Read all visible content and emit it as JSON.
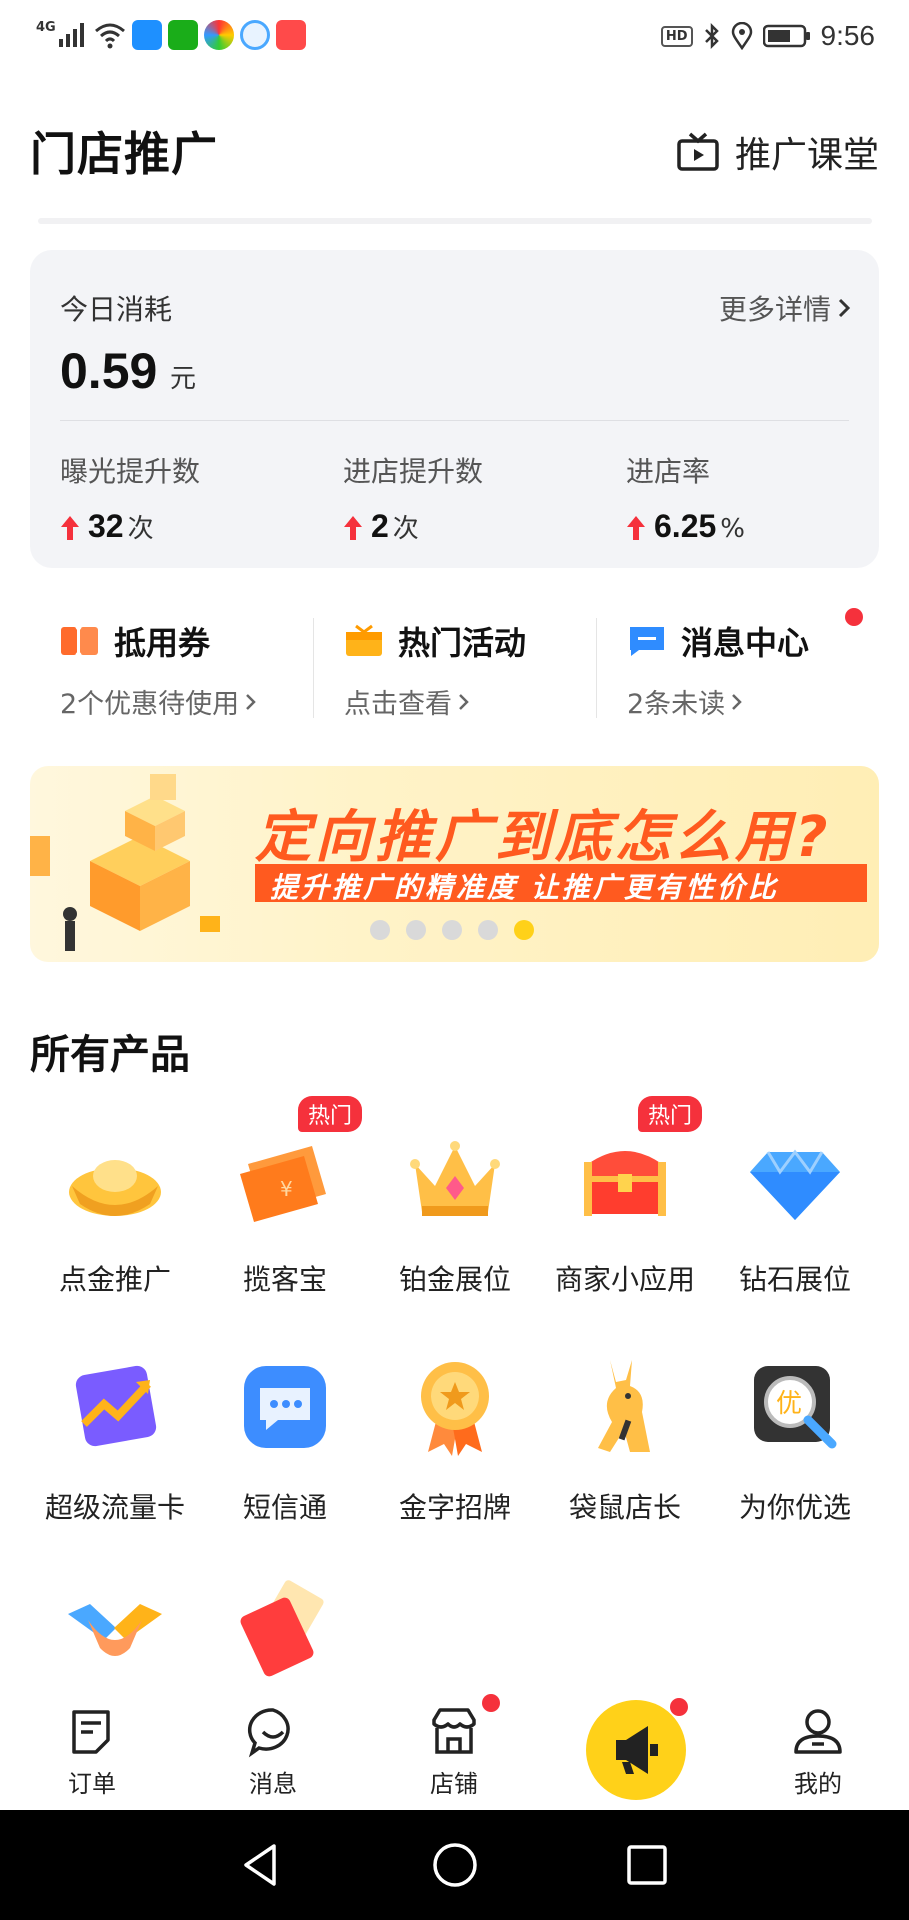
{
  "status_bar": {
    "network": "4G",
    "time": "9:56",
    "hd": "HD"
  },
  "header": {
    "title": "门店推广",
    "classroom_label": "推广课堂"
  },
  "stats": {
    "today_label": "今日消耗",
    "more_label": "更多详情",
    "today_value": "0.59",
    "today_unit": "元",
    "metrics": [
      {
        "label": "曝光提升数",
        "value": "32",
        "unit": "次"
      },
      {
        "label": "进店提升数",
        "value": "2",
        "unit": "次"
      },
      {
        "label": "进店率",
        "value": "6.25",
        "unit": "%"
      }
    ]
  },
  "quick_links": [
    {
      "title": "抵用券",
      "sub": "2个优惠待使用",
      "icon": "coupon-icon"
    },
    {
      "title": "热门活动",
      "sub": "点击查看",
      "icon": "gift-icon"
    },
    {
      "title": "消息中心",
      "sub": "2条未读",
      "icon": "message-icon",
      "has_dot": true
    }
  ],
  "banner": {
    "title": "定向推广到底怎么用?",
    "subtitle": "提升推广的精准度  让推广更有性价比",
    "total_slides": 5,
    "active_slide": 5
  },
  "products": {
    "section_title": "所有产品",
    "hot_badge": "热门",
    "items": [
      {
        "label": "点金推广",
        "icon": "gold-ingot-icon",
        "hot": false
      },
      {
        "label": "揽客宝",
        "icon": "ticket-icon",
        "hot": true
      },
      {
        "label": "铂金展位",
        "icon": "crown-icon",
        "hot": false
      },
      {
        "label": "商家小应用",
        "icon": "treasure-chest-icon",
        "hot": true
      },
      {
        "label": "钻石展位",
        "icon": "diamond-icon",
        "hot": false
      },
      {
        "label": "超级流量卡",
        "icon": "trend-card-icon",
        "hot": false
      },
      {
        "label": "短信通",
        "icon": "chat-bubble-icon",
        "hot": false
      },
      {
        "label": "金字招牌",
        "icon": "medal-icon",
        "hot": false
      },
      {
        "label": "袋鼠店长",
        "icon": "kangaroo-icon",
        "hot": false
      },
      {
        "label": "为你优选",
        "icon": "magnifier-icon",
        "hot": false
      },
      {
        "label": "",
        "icon": "handshake-icon",
        "hot": false
      },
      {
        "label": "",
        "icon": "red-envelope-icon",
        "hot": false
      }
    ]
  },
  "tabbar": {
    "items": [
      {
        "label": "订单",
        "icon": "order-icon"
      },
      {
        "label": "消息",
        "icon": "message-smile-icon"
      },
      {
        "label": "店铺",
        "icon": "store-icon"
      },
      {
        "label": "",
        "icon": "megaphone-icon"
      },
      {
        "label": "我的",
        "icon": "profile-icon"
      }
    ]
  },
  "colors": {
    "accent": "#ffd119",
    "hot": "#f5313c",
    "banner_orange": "#ff5a1f"
  }
}
